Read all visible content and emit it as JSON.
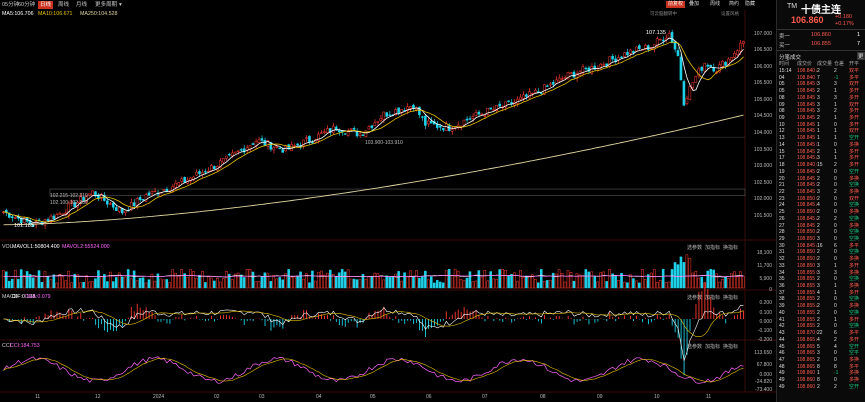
{
  "top_tabs": [
    "05分钟",
    "60分钟",
    "日线",
    "周线",
    "月线",
    "更多周期",
    "▾"
  ],
  "active_tab_index": 2,
  "top_right": [
    "前复权",
    "疊加",
    "周线",
    "简约",
    "隐藏"
  ],
  "hint_text": "可云脑翻转中",
  "settings_label": "设置风格",
  "ma_labels": [
    "MA5:106.706",
    "MA10:106.671",
    "MA250:104.528"
  ],
  "ma_colors": [
    "#ffffff",
    "#e6c200",
    "#e0d5a0"
  ],
  "price_annotations": {
    "high": "107.135",
    "low": "101.185",
    "mid": "103.900-103.910",
    "box": [
      "102.215-102.310",
      "102.100-102.180"
    ]
  },
  "price_axis": [
    "107.000",
    "106.500",
    "106.000",
    "105.500",
    "105.000",
    "104.500",
    "104.000",
    "103.500",
    "103.000",
    "102.500",
    "102.000",
    "101.500"
  ],
  "volume_labels": [
    "VOL",
    "MAVOL1:50804.400",
    "MAVOL2:55524.000"
  ],
  "volume_axis": [
    "18,100",
    "11,700",
    "5,900",
    "0"
  ],
  "macd_labels": [
    "MACD",
    "DIF:0.138",
    "DEA:0.079"
  ],
  "macd_axis": [
    "0.200",
    "0.100",
    "0.000",
    "-0.100",
    "-0.200"
  ],
  "cci_labels": [
    "CCI",
    "CCI:184.753"
  ],
  "cci_axis": [
    "113.650",
    "67.800",
    "0.000",
    "-24.820",
    "-73.400"
  ],
  "indicator_buttons": [
    "选参数",
    "加指标",
    "换指标"
  ],
  "x_axis": [
    "11",
    "12",
    "2024",
    "02",
    "03",
    "04",
    "05",
    "06",
    "07",
    "08",
    "09",
    "10",
    "11"
  ],
  "quote": {
    "code": "TM",
    "name": "十债主连",
    "price": "106.860",
    "change": "+0.180",
    "change_pct": "+0.17%",
    "sell_label": "卖一",
    "sell_price": "106.860",
    "sell_vol": "1",
    "buy_label": "买一",
    "buy_price": "106.855",
    "buy_vol": "7",
    "ticks_title": "分笔成交",
    "more_btn": "更",
    "tick_header": [
      "时间",
      "成交价",
      "成交量",
      "仓差",
      "开平"
    ],
    "ticks": [
      [
        "15:14",
        "108.840↓",
        "2",
        "2",
        "双平"
      ],
      [
        "04",
        "108.840",
        "7",
        "-1",
        "多平"
      ],
      [
        "05",
        "108.845↑",
        "3",
        "3",
        "双开"
      ],
      [
        "05",
        "108.845",
        "2",
        "1",
        "多开"
      ],
      [
        "08",
        "108.845",
        "3",
        "3",
        "多开"
      ],
      [
        "09",
        "108.845",
        "3",
        "1",
        "双开"
      ],
      [
        "08",
        "108.845",
        "3",
        "2",
        "多开"
      ],
      [
        "09",
        "108.845",
        "2",
        "1",
        "多开"
      ],
      [
        "10",
        "108.845",
        "1",
        "0",
        "多开"
      ],
      [
        "12",
        "108.845",
        "1",
        "1",
        "双开"
      ],
      [
        "13",
        "108.845",
        "1",
        "1",
        "空开"
      ],
      [
        "14",
        "108.845↑",
        "1",
        "0",
        "多换"
      ],
      [
        "15",
        "108.845",
        "2",
        "1",
        "多开"
      ],
      [
        "17",
        "108.845↓",
        "3",
        "1",
        "多开"
      ],
      [
        "18",
        "108.840↑",
        "15",
        "2",
        "多开"
      ],
      [
        "19",
        "108.845↑",
        "2",
        "0",
        "空开"
      ],
      [
        "20",
        "108.845",
        "2",
        "0",
        "多换"
      ],
      [
        "21",
        "108.845↑",
        "2",
        "0",
        "空换"
      ],
      [
        "22",
        "108.845",
        "3",
        "2",
        "多换"
      ],
      [
        "23",
        "108.850↑",
        "2",
        "0",
        "双开"
      ],
      [
        "24",
        "108.845↓",
        "4",
        "0",
        "空换"
      ],
      [
        "25",
        "108.850↑",
        "2",
        "0",
        "多换"
      ],
      [
        "26",
        "108.845↓",
        "2",
        "2",
        "空换"
      ],
      [
        "27",
        "108.845",
        "2",
        "0",
        "多换"
      ],
      [
        "28",
        "108.850↓",
        "2",
        "0",
        "空换"
      ],
      [
        "29",
        "108.850",
        "3",
        "0",
        "空换"
      ],
      [
        "30",
        "108.845↓",
        "16",
        "6",
        "多平"
      ],
      [
        "31",
        "108.850",
        "2",
        "0",
        "空换"
      ],
      [
        "32",
        "108.850↑",
        "2",
        "0",
        "多换"
      ],
      [
        "33",
        "108.850",
        "3",
        "1",
        "多开"
      ],
      [
        "34",
        "108.855↑",
        "3",
        "3",
        "多换"
      ],
      [
        "35",
        "108.855",
        "2",
        "0",
        "空换"
      ],
      [
        "36",
        "108.855",
        "3",
        "1",
        "多换"
      ],
      [
        "37",
        "108.855",
        "4",
        "1",
        "多开"
      ],
      [
        "38",
        "108.855",
        "2",
        "0",
        "空换"
      ],
      [
        "39",
        "108.855↓",
        "2",
        "0",
        "多换"
      ],
      [
        "40",
        "108.855",
        "2",
        "0",
        "空换"
      ],
      [
        "41",
        "108.855",
        "2",
        "1",
        "多开"
      ],
      [
        "42",
        "108.855",
        "2",
        "0",
        "空换"
      ],
      [
        "43",
        "108.870↑",
        "22",
        "6",
        "多平"
      ],
      [
        "44",
        "108.865↓",
        "4",
        "2",
        "多开"
      ],
      [
        "45",
        "108.865",
        "5",
        "4",
        "空开"
      ],
      [
        "46",
        "108.865",
        "3",
        "0",
        "空平"
      ],
      [
        "47",
        "108.865",
        "2",
        "0",
        "多换"
      ],
      [
        "48",
        "108.865",
        "8",
        "8",
        "多平"
      ],
      [
        "49",
        "108.860",
        "1",
        "-1",
        "多换"
      ],
      [
        "49",
        "108.860",
        "8",
        "0",
        "多换"
      ],
      [
        "49",
        "108.860",
        "2",
        "2",
        "空开"
      ]
    ]
  }
}
